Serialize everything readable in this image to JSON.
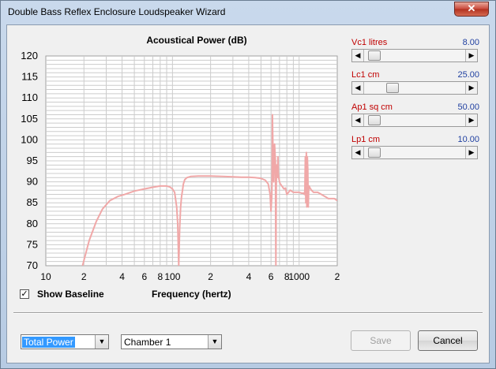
{
  "window": {
    "title": "Double Bass Reflex Enclosure Loudspeaker Wizard",
    "close_symbol": "✕"
  },
  "sliders": [
    {
      "name": "Vc1",
      "unit": "litres",
      "value": "8.00",
      "thumb_fraction": 0.05
    },
    {
      "name": "Lc1",
      "unit": "cm",
      "value": "25.00",
      "thumb_fraction": 0.25
    },
    {
      "name": "Ap1",
      "unit": "sq cm",
      "value": "50.00",
      "thumb_fraction": 0.05
    },
    {
      "name": "Lp1",
      "unit": "cm",
      "value": "10.00",
      "thumb_fraction": 0.05
    }
  ],
  "slider_labels": [
    "Vc1  litres",
    "Lc1  cm",
    "Ap1  sq cm",
    "Lp1  cm"
  ],
  "show_baseline": {
    "label": "Show Baseline",
    "checked": true,
    "check_mark": "✓"
  },
  "bottom": {
    "measure_select": "Total Power",
    "chamber_select": "Chamber 1",
    "save_label": "Save",
    "cancel_label": "Cancel"
  },
  "colors": {
    "curve": "#f0a8a8",
    "plot_bg": "#ffffff",
    "grid": "#cccccc",
    "select_highlight": "#3399ff"
  },
  "chart_data": {
    "type": "line",
    "title": "Acoustical Power (dB)",
    "xlabel": "Frequency (hertz)",
    "ylabel": "",
    "xscale": "log",
    "xlim": [
      10,
      2000
    ],
    "ylim": [
      70,
      120
    ],
    "yticks": [
      70,
      75,
      80,
      85,
      90,
      95,
      100,
      105,
      110,
      115,
      120
    ],
    "xtick_labels": [
      {
        "value": 10,
        "label": "10"
      },
      {
        "value": 20,
        "label": "2"
      },
      {
        "value": 40,
        "label": "4"
      },
      {
        "value": 60,
        "label": "6"
      },
      {
        "value": 80,
        "label": "8"
      },
      {
        "value": 100,
        "label": "100"
      },
      {
        "value": 200,
        "label": "2"
      },
      {
        "value": 400,
        "label": "4"
      },
      {
        "value": 600,
        "label": "6"
      },
      {
        "value": 800,
        "label": "8"
      },
      {
        "value": 1000,
        "label": "1000"
      },
      {
        "value": 2000,
        "label": "2"
      }
    ],
    "grid": true,
    "series": [
      {
        "x": [
          19.5,
          22,
          25,
          28,
          32,
          37,
          42,
          50,
          60,
          70,
          80,
          90,
          95,
          100,
          104,
          108,
          110,
          112,
          114,
          116,
          118,
          120,
          122,
          125,
          130,
          140,
          160,
          200,
          250,
          300,
          350,
          400,
          450,
          500,
          540,
          570,
          590,
          600,
          608,
          612,
          615,
          620,
          630,
          640,
          650,
          655,
          660,
          664,
          668,
          672,
          676,
          680,
          685,
          690,
          695,
          700,
          710,
          720,
          730,
          740,
          750,
          760,
          780,
          800,
          850,
          900,
          950,
          1000,
          1050,
          1080,
          1100,
          1110,
          1120,
          1130,
          1140,
          1150,
          1160,
          1170,
          1180,
          1190,
          1200,
          1220,
          1250,
          1300,
          1400,
          1500,
          1600,
          1700,
          1800,
          1900,
          2000
        ],
        "y": [
          70,
          76,
          80.5,
          83.5,
          85.5,
          86.5,
          87,
          87.8,
          88.3,
          88.7,
          89,
          89,
          88.8,
          88.3,
          87.5,
          84,
          80,
          70,
          79,
          84,
          86.5,
          88,
          89.5,
          90.5,
          91,
          91.3,
          91.4,
          91.4,
          91.3,
          91.2,
          91.1,
          91.1,
          91,
          90.8,
          90.4,
          89.5,
          87,
          83,
          86.5,
          91,
          106,
          100,
          90,
          99,
          95,
          70,
          89,
          94,
          93,
          91,
          92,
          96,
          92,
          91,
          90.5,
          90,
          89.5,
          89.3,
          89,
          88.8,
          88.5,
          88.3,
          88.5,
          87,
          88,
          87.5,
          87.5,
          87.5,
          87.3,
          87.3,
          87,
          88,
          96,
          85,
          97,
          84,
          96,
          93,
          84,
          88,
          89,
          88.5,
          88,
          87.5,
          87.5,
          87,
          86.5,
          86,
          86,
          86,
          85.5
        ]
      }
    ]
  }
}
